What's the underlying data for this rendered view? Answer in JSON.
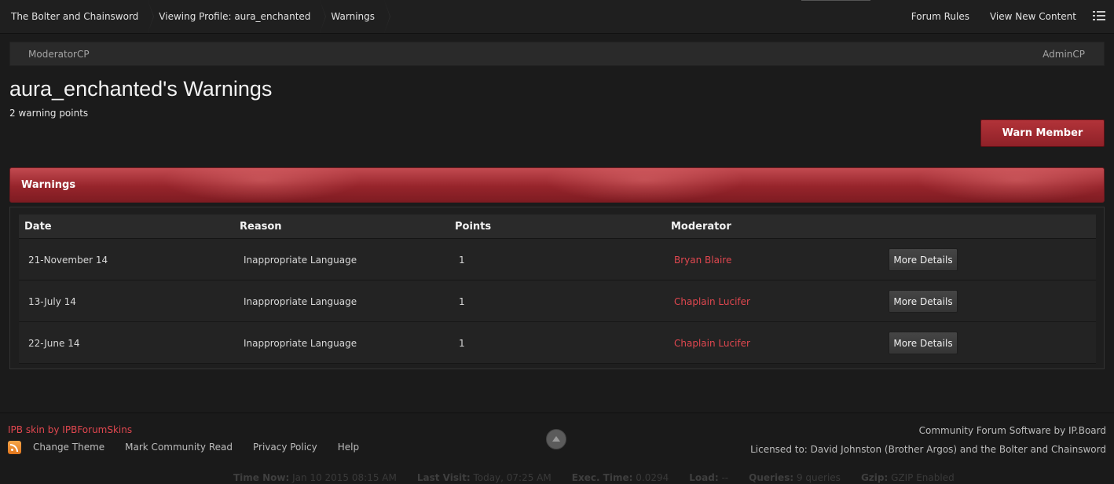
{
  "breadcrumbs": [
    "The Bolter and Chainsword",
    "Viewing Profile: aura_enchanted",
    "Warnings"
  ],
  "top_links": {
    "rules": "Forum Rules",
    "new_content": "View New Content"
  },
  "modbar": {
    "left": "ModeratorCP",
    "right": "AdminCP"
  },
  "page": {
    "title": "aura_enchanted's Warnings",
    "points": "2 warning points",
    "warn_button": "Warn Member",
    "section_title": "Warnings"
  },
  "table": {
    "headers": {
      "date": "Date",
      "reason": "Reason",
      "points": "Points",
      "moderator": "Moderator"
    },
    "rows": [
      {
        "date": "21-November 14",
        "reason": "Inappropriate Language",
        "points": "1",
        "moderator": "Bryan Blaire",
        "action": "More Details"
      },
      {
        "date": "13-July 14",
        "reason": "Inappropriate Language",
        "points": "1",
        "moderator": "Chaplain Lucifer",
        "action": "More Details"
      },
      {
        "date": "22-June 14",
        "reason": "Inappropriate Language",
        "points": "1",
        "moderator": "Chaplain Lucifer",
        "action": "More Details"
      }
    ]
  },
  "footer": {
    "skin_credit": "IPB skin by IPBForumSkins",
    "links": [
      "Change Theme",
      "Mark Community Read",
      "Privacy Policy",
      "Help"
    ],
    "software": "Community Forum Software by IP.Board",
    "license": "Licensed to: David Johnston (Brother Argos) and the Bolter and Chainsword",
    "stats": {
      "time_now_label": "Time Now:",
      "time_now": "Jan 10 2015 08:15 AM",
      "last_visit_label": "Last Visit:",
      "last_visit": "Today, 07:25 AM",
      "exec_label": "Exec. Time:",
      "exec": "0.0294",
      "load_label": "Load:",
      "load": "--",
      "queries_label": "Queries:",
      "queries": "9 queries",
      "gzip_label": "Gzip:",
      "gzip": "GZIP Enabled"
    }
  },
  "icons": {
    "menu": "list-menu-icon",
    "rss": "rss-icon",
    "back_to_top": "arrow-up-icon"
  },
  "colors": {
    "accent_red": "#b23339",
    "link_red": "#e0474f",
    "background": "#1b1b1b"
  }
}
